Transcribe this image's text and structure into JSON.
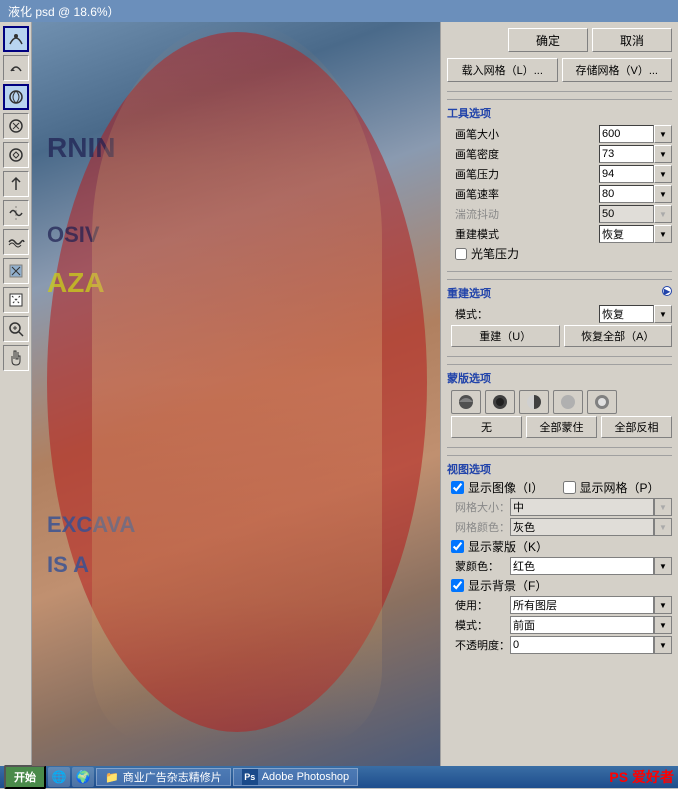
{
  "titleBar": {
    "title": "液化 psd @ 18.6%）"
  },
  "toolbar": {
    "tools": [
      {
        "name": "forward-warp",
        "icon": "✎"
      },
      {
        "name": "reconstruct",
        "icon": "↩"
      },
      {
        "name": "twirl",
        "icon": "✿"
      },
      {
        "name": "pucker",
        "icon": "◎"
      },
      {
        "name": "bloat",
        "icon": "◉"
      },
      {
        "name": "push-left",
        "icon": "⌖"
      },
      {
        "name": "mirror",
        "icon": "〜"
      },
      {
        "name": "turbulence",
        "icon": "≋"
      },
      {
        "name": "freeze-mask",
        "icon": "✏"
      },
      {
        "name": "thaw-mask",
        "icon": "✐"
      },
      {
        "name": "zoom",
        "icon": "🔍"
      },
      {
        "name": "hand",
        "icon": "✋"
      }
    ]
  },
  "buttons": {
    "ok": "确定",
    "cancel": "取消",
    "load_mesh": "载入网格（L）...",
    "save_mesh": "存储网格（V）..."
  },
  "toolOptions": {
    "header": "工具选项",
    "brush_size_label": "画笔大小",
    "brush_size_value": "600",
    "brush_density_label": "画笔密度",
    "brush_density_value": "73",
    "brush_pressure_label": "画笔压力",
    "brush_pressure_value": "94",
    "brush_speed_label": "画笔速率",
    "brush_speed_value": "80",
    "turbulent_jitter_label": "湍流抖动",
    "turbulent_jitter_value": "50",
    "reconstruct_mode_label": "重建模式",
    "reconstruct_mode_value": "恢复",
    "stylus_pressure_label": "光笔压力"
  },
  "rebuildSection": {
    "header": "重建选项",
    "mode_label": "模式：",
    "mode_value": "恢复",
    "rebuild_btn": "重建（U）",
    "restore_btn": "恢复全部（A）"
  },
  "maskSection": {
    "header": "蒙版选项",
    "none_btn": "无",
    "mask_all_btn": "全部蒙住",
    "invert_btn": "全部反相"
  },
  "viewSection": {
    "header": "视图选项",
    "show_image_label": "显示图像（I）",
    "show_mesh_label": "显示网格（P）",
    "mesh_size_label": "网格大小：",
    "mesh_size_value": "中",
    "mesh_color_label": "网格颜色：",
    "mesh_color_value": "灰色",
    "show_mask_label": "显示蒙版（K）",
    "mask_color_label": "蒙颜色：",
    "mask_color_value": "红色",
    "show_bg_label": "显示背景（F）",
    "use_label": "使用：",
    "use_value": "所有图层",
    "mode_label": "模式：",
    "mode_value": "前面",
    "opacity_label": "不透明度：",
    "opacity_value": "0"
  },
  "taskbar": {
    "start": "开始",
    "items": [
      {
        "label": "商业广告杂志精修片",
        "icon": "📁"
      },
      {
        "label": "Adobe Photoshop",
        "icon": "Ps"
      }
    ],
    "watermark": "PS 爱好者"
  }
}
